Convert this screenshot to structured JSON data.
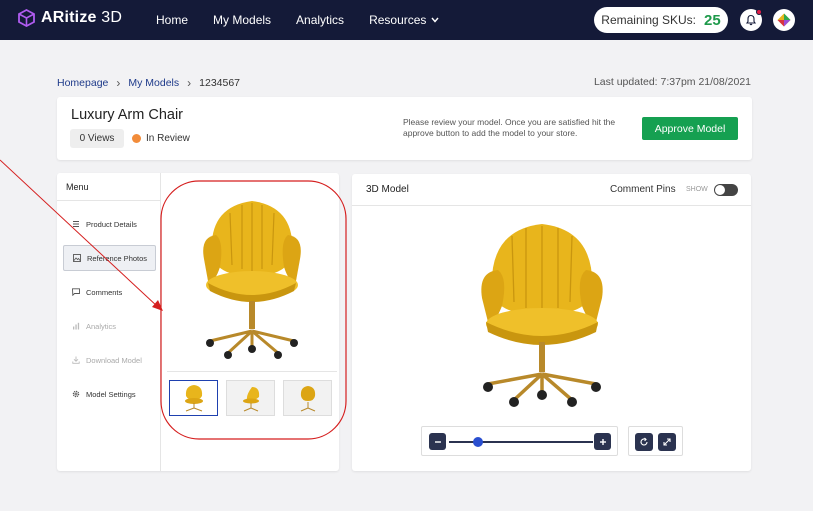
{
  "app": {
    "logo_text_bold": "ARitize",
    "logo_text_light": " 3D"
  },
  "nav": {
    "items": [
      {
        "label": "Home"
      },
      {
        "label": "My Models"
      },
      {
        "label": "Analytics"
      },
      {
        "label": "Resources"
      }
    ]
  },
  "skus": {
    "label": "Remaining SKUs:",
    "count": "25"
  },
  "breadcrumb": {
    "items": [
      "Homepage",
      "My Models",
      "1234567"
    ]
  },
  "last_updated": "Last updated: 7:37pm  21/08/2021",
  "product": {
    "title": "Luxury Arm Chair",
    "views": "0 Views",
    "status": "In Review",
    "note": "Please review your model. Once you are satisfied hit the approve button to add the model to your store.",
    "approve_label": "Approve Model"
  },
  "menu": {
    "title": "Menu",
    "items": [
      {
        "label": "Product Details",
        "icon": "list-icon"
      },
      {
        "label": "Reference Photos",
        "icon": "image-icon"
      },
      {
        "label": "Comments",
        "icon": "comment-icon"
      },
      {
        "label": "Analytics",
        "icon": "bar-chart-icon"
      },
      {
        "label": "Download Model",
        "icon": "download-icon"
      },
      {
        "label": "Model Settings",
        "icon": "gear-icon"
      }
    ]
  },
  "viewer": {
    "title": "3D Model",
    "comment_pins_label": "Comment Pins",
    "show_label": "SHOW",
    "comment_pins_on": false,
    "zoom_level": 0.2
  },
  "colors": {
    "nav_bg": "#141a38",
    "accent_green": "#15a051",
    "chair_yellow": "#e8b51c",
    "chair_gold": "#b8892a",
    "annotation_red": "#d51f1f"
  }
}
